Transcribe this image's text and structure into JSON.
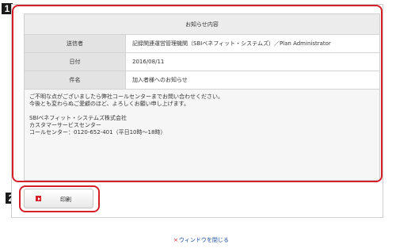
{
  "badges": {
    "first": "1",
    "second": "2"
  },
  "notice": {
    "header": "お知らせ内容",
    "rows": [
      {
        "label": "送信者",
        "value": "記録関連運営管理機関（SBIベネフィット・システムズ）／Plan Administrator"
      },
      {
        "label": "日付",
        "value": "2016/08/11"
      },
      {
        "label": "件名",
        "value": "加入者様へのお知らせ"
      }
    ],
    "body_lines": [
      "ご不明な点がございましたら弊社コールセンターまでお問い合わせください。",
      "今後とも変わらぬご愛顧のほど、よろしくお願い申し上げます。",
      "",
      "SBIベネフィット・システムズ株式会社",
      "カスタマーサービスセンター",
      "コールセンター：0120-652-401（平日10時～18時）"
    ]
  },
  "actions": {
    "print_label": "印刷"
  },
  "footer": {
    "close_icon": "×",
    "close_label": "ウィンドウを閉じる"
  },
  "colors": {
    "highlight": "#d5202a",
    "link": "#1a4fa3"
  }
}
